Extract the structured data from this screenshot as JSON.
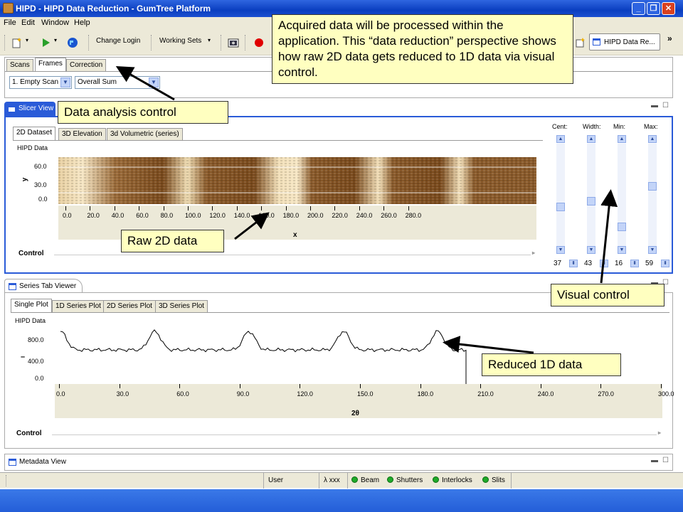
{
  "window": {
    "title": "HIPD - HIPD Data Reduction - GumTree Platform",
    "minimize": "_",
    "restore": "❐",
    "close": "✕"
  },
  "menu": [
    "File",
    "Edit",
    "Window",
    "Help"
  ],
  "toolbar": {
    "change_login": "Change Login",
    "working_sets": "Working Sets",
    "perspective": "HIPD Data Re...",
    "overflow": "»"
  },
  "scan_panel": {
    "tabs": [
      "Scans",
      "Frames",
      "Correction"
    ],
    "scan_select": "1. Empty Scan",
    "frame_select": "Overall Sum"
  },
  "slicer_view": {
    "title": "Slicer View",
    "tabs": [
      "2D Dataset",
      "3D Elevation",
      "3d Volumetric (series)"
    ],
    "plot_title": "HIPD Data",
    "y_axis_label": "y",
    "y_ticks": [
      "60.0",
      "30.0",
      "0.0"
    ],
    "x_ticks": [
      "0.0",
      "20.0",
      "40.0",
      "60.0",
      "80.0",
      "100.0",
      "120.0",
      "140.0",
      "160.0",
      "180.0",
      "200.0",
      "220.0",
      "240.0",
      "260.0",
      "280.0"
    ],
    "x_axis_label": "x",
    "control_label": "Control",
    "slider_labels": [
      "Cent:",
      "Width:",
      "Min:",
      "Max:"
    ],
    "slider_values": [
      "37",
      "43",
      "16",
      "59"
    ],
    "slider_levels": [
      0.37,
      0.43,
      0.16,
      0.59
    ]
  },
  "series_view": {
    "title": "Series Tab Viewer",
    "tabs": [
      "Single Plot",
      "1D Series Plot",
      "2D Series Plot",
      "3D Series Plot"
    ],
    "plot_title": "HIPD Data",
    "y_ticks": [
      "800.0",
      "400.0",
      "0.0"
    ],
    "x_ticks": [
      "0.0",
      "30.0",
      "60.0",
      "90.0",
      "120.0",
      "150.0",
      "180.0",
      "210.0",
      "240.0",
      "270.0",
      "300.0"
    ],
    "x_axis_label": "2θ",
    "control_label": "Control"
  },
  "metadata_view": {
    "title": "Metadata View"
  },
  "statusbar": {
    "user": "User",
    "lambda": "λ xxx",
    "indicators": [
      "Beam",
      "Shutters",
      "Interlocks",
      "Slits"
    ],
    "indicator_color": "#1faa2a"
  },
  "callouts": {
    "intro": "Acquired data will be processed within the application.  This “data reduction” perspective shows how raw 2D data gets reduced to 1D data via visual control.",
    "data_analysis": "Data analysis control",
    "raw_2d": "Raw 2D data",
    "visual_control": "Visual control",
    "reduced_1d": "Reduced 1D data"
  },
  "colors": {
    "title_bar": "#0a3ec0",
    "chrome": "#ece9d8",
    "callout_bg": "#ffffc0",
    "image_light": "#f2dfb8",
    "image_dark": "#7a4a1c"
  }
}
